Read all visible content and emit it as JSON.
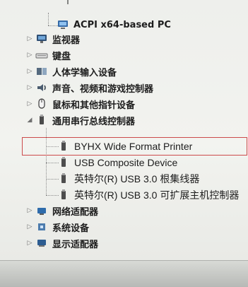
{
  "device_manager": {
    "tree": {
      "acpi": "ACPI x64-based PC",
      "monitor": "监视器",
      "keyboard": "键盘",
      "hid": "人体学输入设备",
      "sound": "声音、视频和游戏控制器",
      "mouse": "鼠标和其他指针设备",
      "usb": "通用串行总线控制器",
      "usb_children": [
        "BYHX Wide Format Printer",
        "USB Composite Device",
        "英特尔(R) USB 3.0 根集线器",
        "英特尔(R) USB 3.0 可扩展主机控制器"
      ],
      "network": "网络适配器",
      "system": "系统设备",
      "display": "显示适配器"
    }
  }
}
